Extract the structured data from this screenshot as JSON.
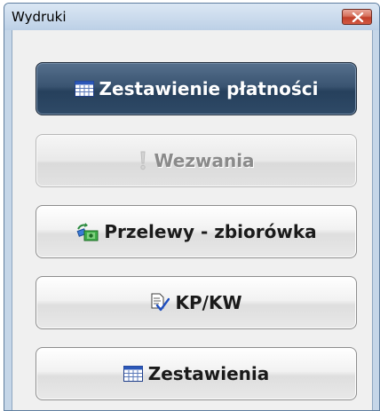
{
  "window": {
    "title": "Wydruki"
  },
  "buttons": [
    {
      "label": "Zestawienie płatności",
      "icon": "table-report-icon",
      "state": "default"
    },
    {
      "label": "Wezwania",
      "icon": "exclamation-icon",
      "state": "disabled"
    },
    {
      "label": "Przelewy - zbiorówka",
      "icon": "money-transfer-icon",
      "state": "normal"
    },
    {
      "label": "KP/KW",
      "icon": "document-check-icon",
      "state": "normal"
    },
    {
      "label": "Zestawienia",
      "icon": "table-report-icon",
      "state": "normal"
    }
  ],
  "colors": {
    "default_button": "#2f4a67",
    "close_button": "#c1402b",
    "title_bar": "#bcd0e6"
  }
}
